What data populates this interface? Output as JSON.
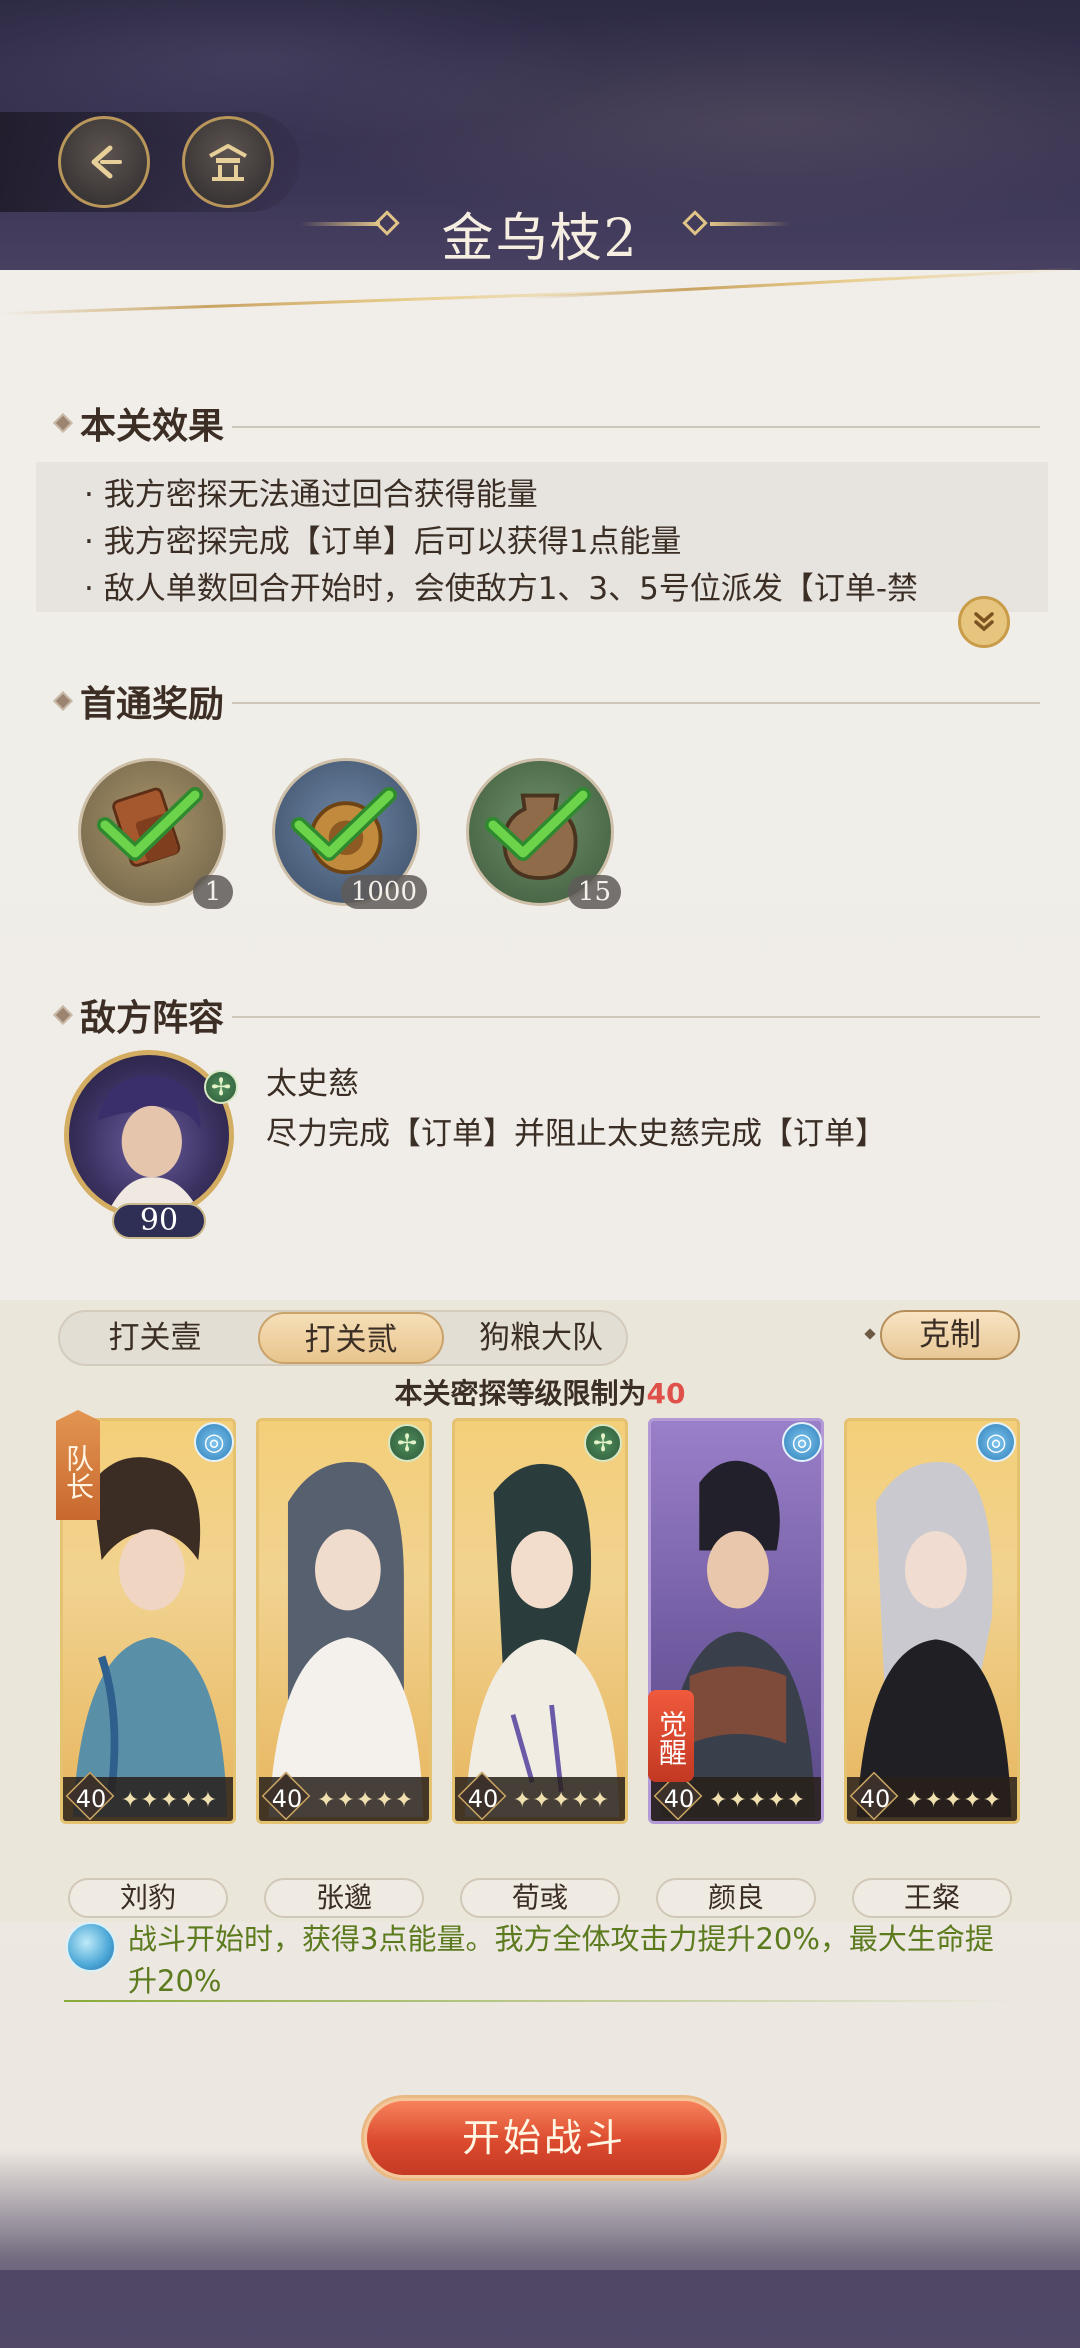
{
  "header": {
    "title": "金乌枝2",
    "back_icon": "back-arrow-icon",
    "home_icon": "pavilion-icon"
  },
  "effects": {
    "heading": "本关效果",
    "lines": [
      "· 我方密探无法通过回合获得能量",
      "· 我方密探完成【订单】后可以获得1点能量",
      "· 敌人单数回合开始时，会使敌方1、3、5号位派发【订单-禁"
    ]
  },
  "first_clear": {
    "heading": "首通奖励",
    "rewards": [
      {
        "icon": "token-pendant-icon",
        "count": "1",
        "claimed": true,
        "bg": "#8a7a55"
      },
      {
        "icon": "coin-icon",
        "count": "1000",
        "claimed": true,
        "bg": "#4b5f7a"
      },
      {
        "icon": "wine-jar-icon",
        "count": "15",
        "claimed": true,
        "bg": "#4e6a4a"
      }
    ]
  },
  "enemy": {
    "heading": "敌方阵容",
    "name": "太史慈",
    "description": "尽力完成【订单】并阻止太史慈完成【订单】",
    "level": "90",
    "element_icon": "green-leaf-icon"
  },
  "team": {
    "tabs": [
      "打关壹",
      "打关贰",
      "狗粮大队"
    ],
    "active_tab": 1,
    "restrain_label": "克制",
    "level_limit_prefix": "本关密探等级限制为",
    "level_limit_value": "40",
    "leader_label": "队长",
    "awaken_label": "觉醒",
    "members": [
      {
        "name": "刘豹",
        "level": "40",
        "stars": "✦✦✦✦✦",
        "element": "blue"
      },
      {
        "name": "张邈",
        "level": "40",
        "stars": "✦✦✦✦✦",
        "element": "green"
      },
      {
        "name": "荀彧",
        "level": "40",
        "stars": "✦✦✦✦✦",
        "element": "green"
      },
      {
        "name": "颜良",
        "level": "40",
        "stars": "✦✦✦✦✦",
        "element": "blue"
      },
      {
        "name": "王粲",
        "level": "40",
        "stars": "✦✦✦✦✦",
        "element": "blue"
      }
    ],
    "bonus_text": "战斗开始时，获得3点能量。我方全体攻击力提升20%，最大生命提升20%"
  },
  "start_label": "开始战斗",
  "colors": {
    "accent_gold": "#c9a463",
    "start_red": "#db4a2e",
    "bonus_green": "#5c7a1e",
    "limit_red": "#e0504a"
  }
}
